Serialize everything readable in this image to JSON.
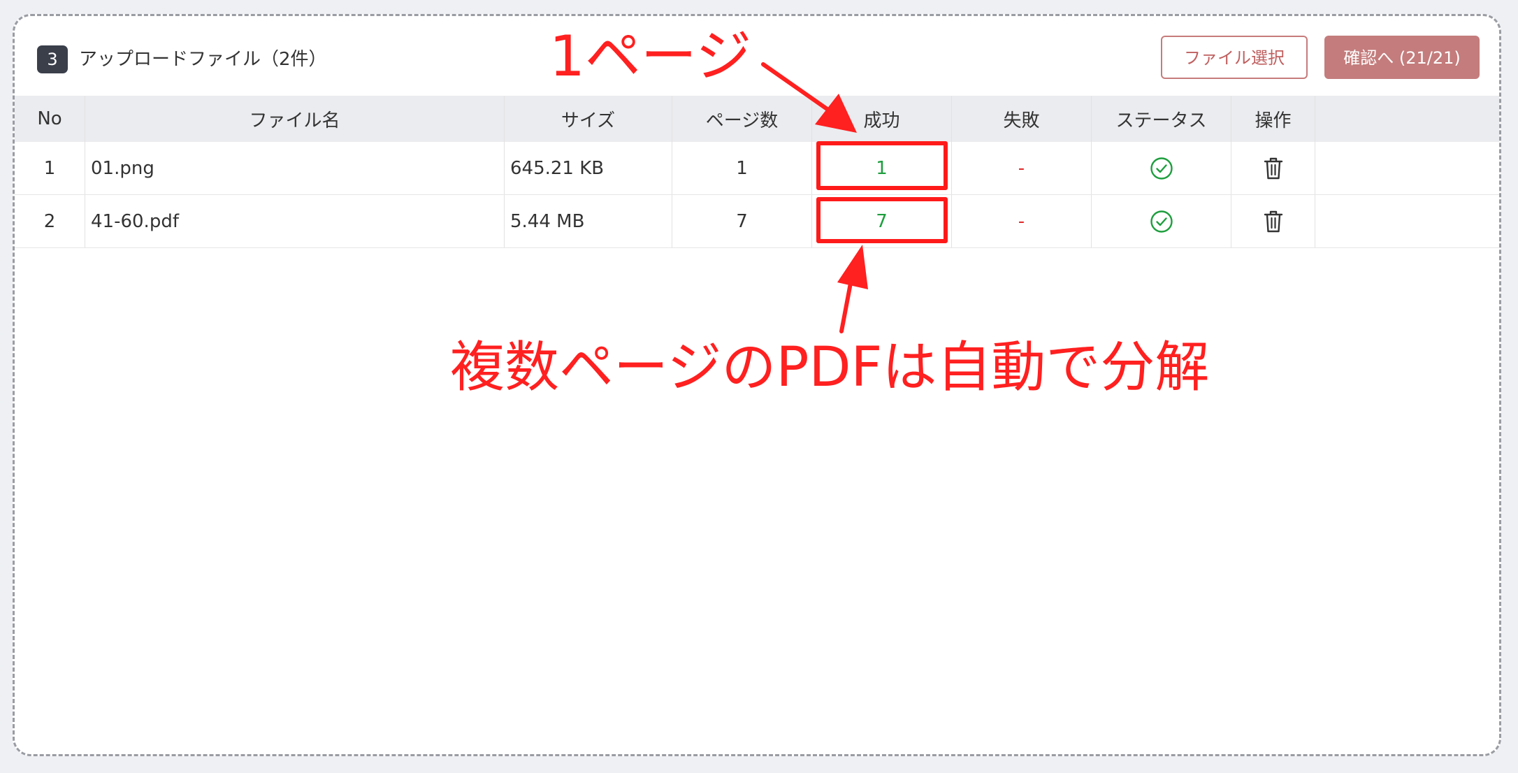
{
  "header": {
    "step_number": "3",
    "title": "アップロードファイル（2件）",
    "select_button_label": "ファイル選択",
    "confirm_button_label": "確認へ (21/21)"
  },
  "table": {
    "columns": [
      "No",
      "ファイル名",
      "サイズ",
      "ページ数",
      "成功",
      "失敗",
      "ステータス",
      "操作"
    ],
    "rows": [
      {
        "no": "1",
        "filename": "01.png",
        "size": "645.21 KB",
        "pages": "1",
        "success": "1",
        "failure": "-",
        "status_icon": "check-circle-icon",
        "action_icon": "trash-icon"
      },
      {
        "no": "2",
        "filename": "41-60.pdf",
        "size": "5.44 MB",
        "pages": "7",
        "success": "7",
        "failure": "-",
        "status_icon": "check-circle-icon",
        "action_icon": "trash-icon"
      }
    ]
  },
  "annotations": {
    "top_label": "1ページ",
    "bottom_label": "複数ページのPDFは自動で分解",
    "color": "#ff2020"
  },
  "colors": {
    "success": "#1e9e3e",
    "failure": "#e02b2b",
    "accent": "#c47c7c"
  }
}
